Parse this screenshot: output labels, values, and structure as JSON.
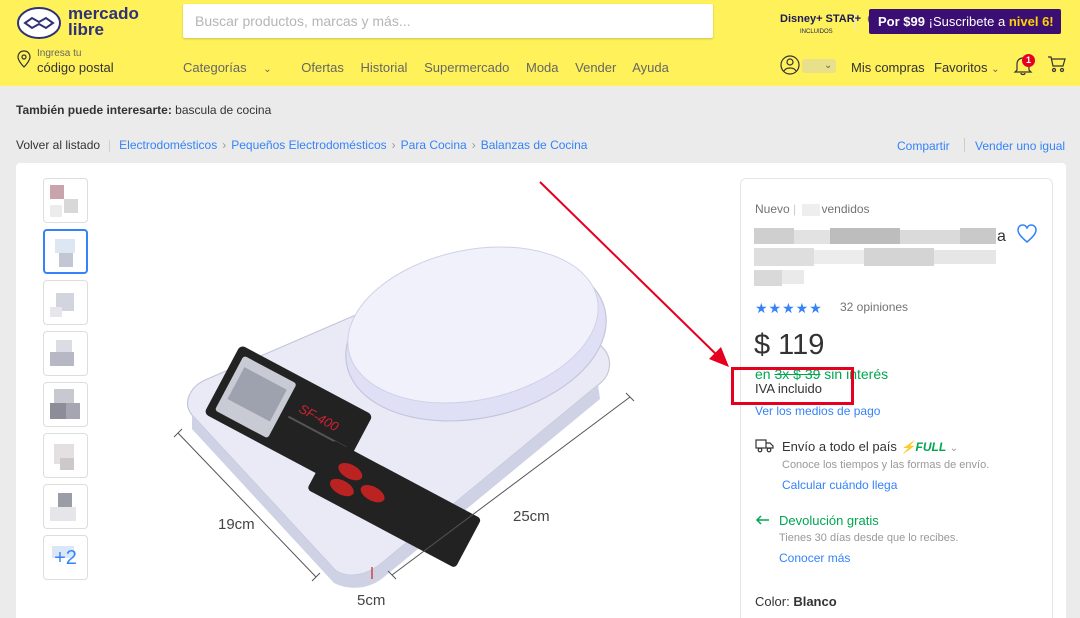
{
  "header": {
    "logo_text_1": "mercado",
    "logo_text_2": "libre",
    "search_placeholder": "Buscar productos, marcas y más...",
    "disney_text": "Disney+ STAR+",
    "disney_sub": "INCLUIDOS",
    "promo_price": "Por $99",
    "promo_text": "¡Suscribete a",
    "promo_level": "nivel 6!",
    "location_line1": "Ingresa tu",
    "location_line2": "código postal",
    "nav": [
      "Categorías",
      "Ofertas",
      "Historial",
      "Supermercado",
      "Moda",
      "Vender",
      "Ayuda"
    ],
    "mis_compras": "Mis compras",
    "favoritos": "Favoritos",
    "notifications_count": "1"
  },
  "also": {
    "label": "También puede interesarte:",
    "value": "bascula de cocina"
  },
  "breadcrumb": {
    "back": "Volver al listado",
    "items": [
      "Electrodomésticos",
      "Pequeños Electrodomésticos",
      "Para Cocina",
      "Balanzas de Cocina"
    ],
    "share": "Compartir",
    "sell": "Vender uno igual"
  },
  "product": {
    "thumbnail_more": "+2",
    "dimension_width": "19cm",
    "dimension_length": "25cm",
    "dimension_height": "5cm",
    "lcd_model": "SF-400"
  },
  "panel": {
    "condition": "Nuevo",
    "sold_suffix": "vendidos",
    "title_end": "a",
    "stars": "★★★★★",
    "rating_count": "32 opiniones",
    "price": "$ 119",
    "cuotas_prefix": "en",
    "cuotas_strike": "3x $ 39",
    "cuotas_suffix": "sin interés",
    "iva": "IVA incluido",
    "payment_link": "Ver los medios de pago",
    "shipping": "Envío a todo el país",
    "full": "FULL",
    "shipping_sub": "Conoce los tiempos y las formas de envío.",
    "shipping_link": "Calcular cuándo llega",
    "return": "Devolución gratis",
    "return_sub": "Tienes 30 días desde que lo recibes.",
    "return_link": "Conocer más",
    "color_label": "Color:",
    "color_value": "Blanco"
  },
  "colors": {
    "header_bg": "#fff159",
    "brand_blue": "#3483fa",
    "green": "#00a650",
    "highlight_red": "#e4001e",
    "promo_purple": "#3b0e73"
  }
}
